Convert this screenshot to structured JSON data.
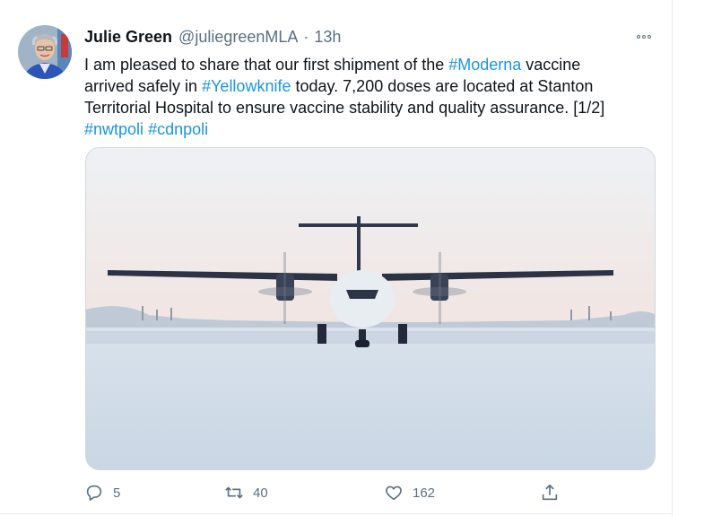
{
  "tweet": {
    "author_name": "Julie Green",
    "handle": "@juliegreenMLA",
    "separator": "·",
    "timestamp": "13h",
    "text_lines": [
      [
        "I am pleased to share that our first shipment of the ",
        "#Moderna",
        " vaccine"
      ],
      [
        "arrived safely in ",
        "#Yellowknife",
        " today. 7,200 doses are located at Stanton"
      ],
      [
        "Territorial Hospital to ensure vaccine stability and quality assurance. [1/2]"
      ],
      [
        "#nwtpoli",
        " ",
        "#cdnpoli"
      ]
    ],
    "hashtags": [
      "#Moderna",
      "#Yellowknife",
      "#nwtpoli",
      "#cdnpoli"
    ]
  },
  "actions": {
    "reply": {
      "icon": "reply-icon",
      "count": "5"
    },
    "retweet": {
      "icon": "retweet-icon",
      "count": "40"
    },
    "like": {
      "icon": "heart-icon",
      "count": "162"
    },
    "share": {
      "icon": "share-icon",
      "count": ""
    }
  },
  "icons": {
    "more": "more-options-icon"
  },
  "colors": {
    "link": "#1b95e0",
    "secondary_text": "#5b7083",
    "primary_text": "#0f1419",
    "border": "#ebeef0"
  }
}
